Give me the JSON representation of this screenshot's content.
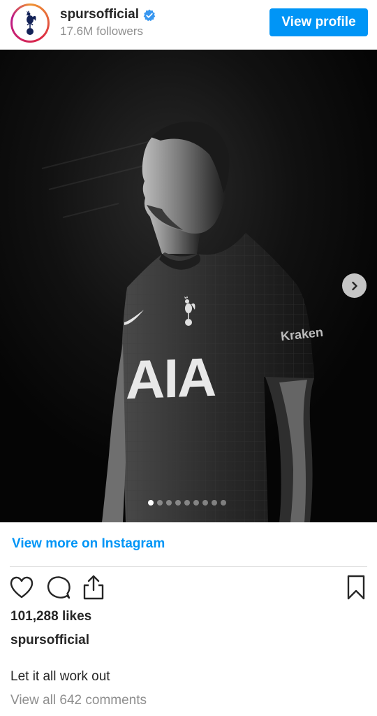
{
  "header": {
    "username": "spursofficial",
    "verified": true,
    "followers": "17.6M followers",
    "view_profile_label": "View profile"
  },
  "post": {
    "carousel": {
      "total_slides": 9,
      "active_slide": 1
    },
    "shirt_sponsor": "AIA",
    "sleeve_sponsor": "Kraken",
    "view_more_label": "View more on Instagram",
    "likes": "101,288 likes",
    "poster": "spursofficial",
    "caption": "Let it all work out",
    "comments_link": "View all 642 comments"
  },
  "colors": {
    "accent": "#0095f6",
    "text": "#262626",
    "muted": "#8e8e8e",
    "divider": "#dbdbdb"
  },
  "icons": {
    "heart": "heart-icon",
    "comment": "comment-icon",
    "share": "share-icon",
    "save": "bookmark-icon",
    "next": "chevron-right-icon",
    "verified": "verified-badge-icon"
  }
}
